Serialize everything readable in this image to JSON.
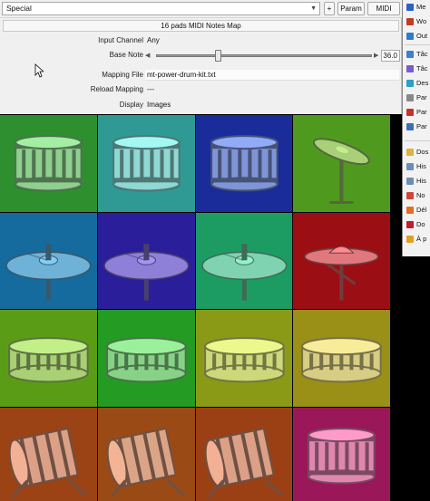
{
  "toolbar": {
    "preset": "Special",
    "plus_label": "+",
    "param_label": "Param",
    "midi_label": "MIDI"
  },
  "plugin": {
    "title": "16 pads MIDI Notes Map",
    "input_channel": {
      "label": "Input Channel",
      "value": "Any"
    },
    "base_note": {
      "label": "Base Note",
      "value": "36.0"
    },
    "mapping_file": {
      "label": "Mapping File",
      "value": "mt-power-drum-kit.txt"
    },
    "reload_mapping": {
      "label": "Reload Mapping",
      "value": "---"
    },
    "display": {
      "label": "Display",
      "value": "Images"
    }
  },
  "pads": [
    {
      "bg": "#2e8f2e",
      "color": "#8fcf8f",
      "icon": "snare-drum-icon"
    },
    {
      "bg": "#2e9a93",
      "color": "#8fd8d4",
      "icon": "snare-drum-icon"
    },
    {
      "bg": "#1a2b9a",
      "color": "#7f95d8",
      "icon": "snare-drum-icon"
    },
    {
      "bg": "#4f9a1e",
      "color": "#a9d078",
      "icon": "crash-cymbal-icon"
    },
    {
      "bg": "#156a9e",
      "color": "#6fb2d8",
      "icon": "ride-cymbal-icon"
    },
    {
      "bg": "#2b1e9a",
      "color": "#8e7fd8",
      "icon": "ride-cymbal-icon"
    },
    {
      "bg": "#1c9c63",
      "color": "#7fd3b0",
      "icon": "ride-cymbal-icon"
    },
    {
      "bg": "#9b0f14",
      "color": "#e0797d",
      "icon": "china-cymbal-icon"
    },
    {
      "bg": "#5b9c17",
      "color": "#a9d075",
      "icon": "tom-drum-icon"
    },
    {
      "bg": "#249b22",
      "color": "#87d287",
      "icon": "tom-drum-icon"
    },
    {
      "bg": "#8a9a17",
      "color": "#cdd87a",
      "icon": "tom-drum-icon"
    },
    {
      "bg": "#9a8f17",
      "color": "#d8cd85",
      "icon": "tom-drum-icon"
    },
    {
      "bg": "#9b4315",
      "color": "#dca087",
      "icon": "bass-drum-icon"
    },
    {
      "bg": "#9a4a14",
      "color": "#dca487",
      "icon": "bass-drum-icon"
    },
    {
      "bg": "#9b4015",
      "color": "#dca087",
      "icon": "bass-drum-icon"
    },
    {
      "bg": "#9a175a",
      "color": "#e087b0",
      "icon": "snare-drum-icon"
    }
  ],
  "context_menu": [
    {
      "label": "Me",
      "icon": "arrow-icon",
      "color": "#2a62c9"
    },
    {
      "label": "Wo",
      "icon": "grid-icon",
      "color": "#c23b22"
    },
    {
      "label": "Out",
      "icon": "output-icon",
      "color": "#2e7bcf"
    },
    {
      "label": "Tâc",
      "icon": "task-icon",
      "color": "#3d7fd1"
    },
    {
      "label": "Tâc",
      "icon": "task-icon",
      "color": "#7a5bd1"
    },
    {
      "label": "Des",
      "icon": "desktop-icon",
      "color": "#2aa0c9"
    },
    {
      "label": "Par",
      "icon": "settings-icon",
      "color": "#888888"
    },
    {
      "label": "Par",
      "icon": "tools-icon",
      "color": "#c9302a"
    },
    {
      "label": "Par",
      "icon": "window-icon",
      "color": "#3a6fb7"
    },
    {
      "label": "Dos",
      "icon": "folder-icon",
      "color": "#e0b23a"
    },
    {
      "label": "His",
      "icon": "history-icon",
      "color": "#6a8fb7"
    },
    {
      "label": "His",
      "icon": "history-icon",
      "color": "#6a8fb7"
    },
    {
      "label": "No",
      "icon": "notification-icon",
      "color": "#d0473a"
    },
    {
      "label": "Dél",
      "icon": "warning-icon",
      "color": "#e07020"
    },
    {
      "label": "Do",
      "icon": "heart-icon",
      "color": "#c21d2a"
    },
    {
      "label": "À p",
      "icon": "star-icon",
      "color": "#e0a020"
    }
  ]
}
